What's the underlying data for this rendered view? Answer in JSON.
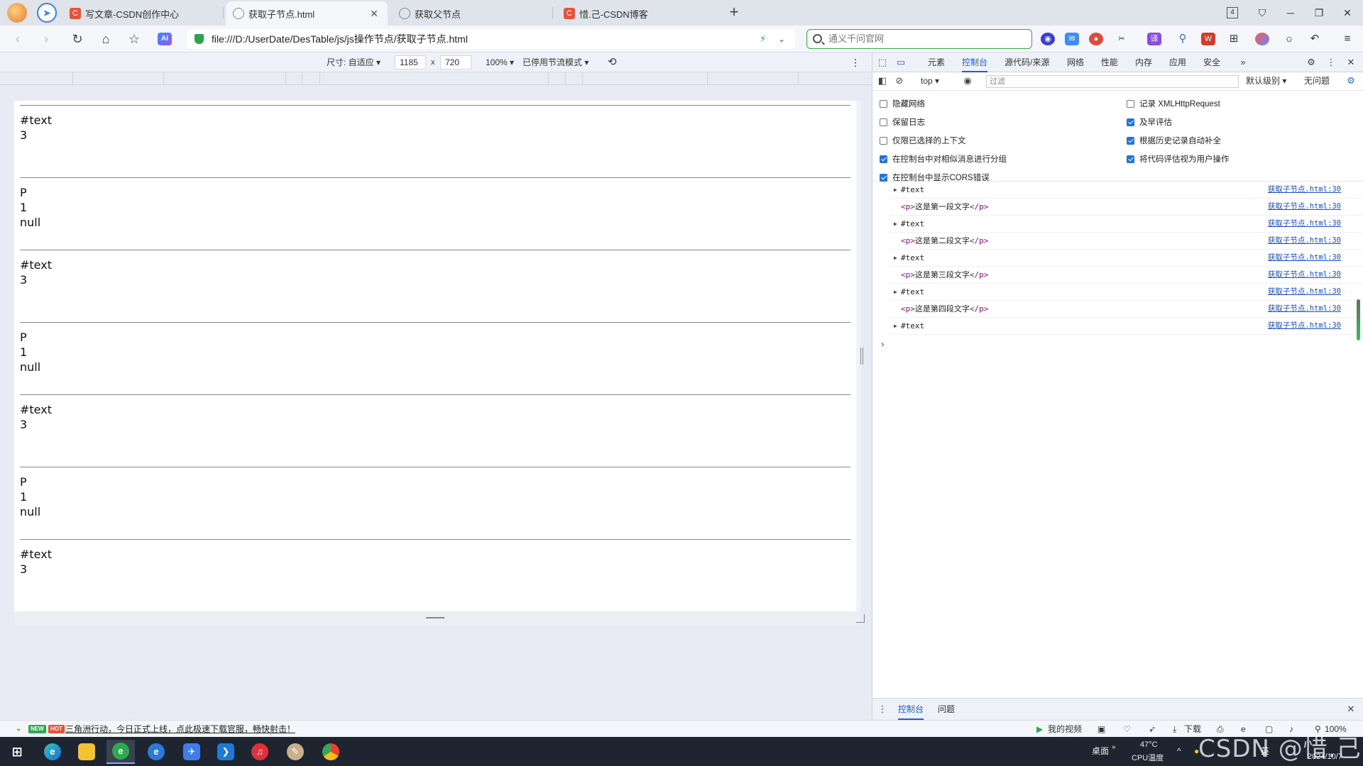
{
  "tabs": [
    {
      "label": "写文章-CSDN创作中心",
      "icon": "csdn-logo-icon"
    },
    {
      "label": "获取子节点.html",
      "icon": "globe-icon",
      "active": true
    },
    {
      "label": "获取父节点",
      "icon": "globe-icon"
    },
    {
      "label": "惜.己-CSDN博客",
      "icon": "csdn-logo-icon"
    }
  ],
  "tab_count": "4",
  "address": {
    "url": "file:///D:/UserDate/DesTable/js/js操作节点/获取子节点.html"
  },
  "search": {
    "placeholder": "通义千问官网"
  },
  "ai_label": "AI",
  "device_toolbar": {
    "size_label": "尺寸: 自适应",
    "width": "1185",
    "times": "x",
    "height": "720",
    "zoom": "100%",
    "throttle": "已停用节流模式"
  },
  "page_blocks": [
    {
      "lines": [
        "#text",
        "3"
      ]
    },
    {
      "lines": [
        "P",
        "1",
        "null"
      ]
    },
    {
      "lines": [
        "#text",
        "3"
      ]
    },
    {
      "lines": [
        "P",
        "1",
        "null"
      ]
    },
    {
      "lines": [
        "#text",
        "3"
      ]
    },
    {
      "lines": [
        "P",
        "1",
        "null"
      ]
    },
    {
      "lines": [
        "#text",
        "3"
      ]
    }
  ],
  "devtools": {
    "tabs": [
      "元素",
      "控制台",
      "源代码/来源",
      "网络",
      "性能",
      "内存",
      "应用",
      "安全"
    ],
    "active_tab": "控制台",
    "context": "top",
    "filter_placeholder": "过滤",
    "level": "默认级别",
    "issues": "无问题",
    "settings_left": [
      {
        "label": "隐藏网络",
        "checked": false
      },
      {
        "label": "保留日志",
        "checked": false
      },
      {
        "label": "仅限已选择的上下文",
        "checked": false
      },
      {
        "label": "在控制台中对相似消息进行分组",
        "checked": true
      },
      {
        "label": "在控制台中显示CORS错误",
        "checked": true
      }
    ],
    "settings_right": [
      {
        "label": "记录 XMLHttpRequest",
        "checked": false
      },
      {
        "label": "及早评估",
        "checked": true
      },
      {
        "label": "根据历史记录自动补全",
        "checked": true
      },
      {
        "label": "将代码评估视为用户操作",
        "checked": true
      }
    ],
    "logs": [
      {
        "kind": "text",
        "text": "#text",
        "source": "获取子节点.html:30"
      },
      {
        "kind": "p",
        "open": "<p>",
        "text": "这是第一段文字",
        "close": "</p>",
        "source": "获取子节点.html:30"
      },
      {
        "kind": "text",
        "text": "#text",
        "source": "获取子节点.html:30"
      },
      {
        "kind": "p",
        "open": "<p>",
        "text": "这是第二段文字",
        "close": "</p>",
        "source": "获取子节点.html:30"
      },
      {
        "kind": "text",
        "text": "#text",
        "source": "获取子节点.html:30"
      },
      {
        "kind": "p",
        "open": "<p>",
        "text": "这是第三段文字",
        "close": "</p>",
        "source": "获取子节点.html:30"
      },
      {
        "kind": "text",
        "text": "#text",
        "source": "获取子节点.html:30"
      },
      {
        "kind": "p",
        "open": "<p>",
        "text": "这是第四段文字",
        "close": "</p>",
        "source": "获取子节点.html:30"
      },
      {
        "kind": "text",
        "text": "#text",
        "source": "获取子节点.html:30"
      }
    ],
    "prompt": "›",
    "drawer_tabs": [
      "控制台",
      "问题"
    ]
  },
  "statusbar": {
    "badge_new": "NEW",
    "badge_hot": "HOT",
    "news": "三角洲行动，今日正式上线，点此极速下载官服，畅快射击！",
    "my_video": "我的视频",
    "download": "下载",
    "zoom": "100%"
  },
  "taskbar": {
    "desktop": "桌面",
    "temperature": "47°C",
    "cpu": "CPU温度",
    "ime": "英",
    "date": "2024/10/7"
  },
  "watermark": "CSDN @惜.己"
}
